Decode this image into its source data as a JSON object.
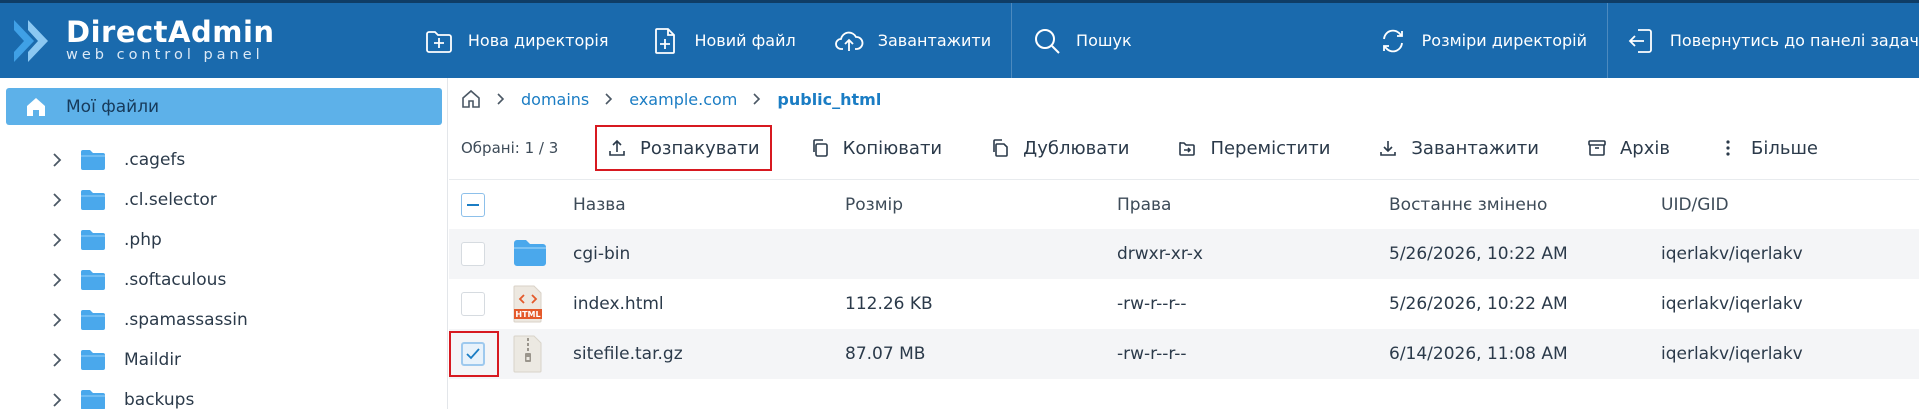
{
  "header": {
    "logo_title": "DirectAdmin",
    "logo_subtitle": "web control panel",
    "buttons": {
      "new_dir": "Нова директорія",
      "new_file": "Новий файл",
      "upload": "Завантажити",
      "search": "Пошук",
      "dir_sizes": "Розміри директорій",
      "back": "Повернутись до панелі задач"
    }
  },
  "sidebar": {
    "active_label": "Мої файли",
    "items": [
      ".cagefs",
      ".cl.selector",
      ".php",
      ".softaculous",
      ".spamassassin",
      "Maildir",
      "backups"
    ]
  },
  "breadcrumb": {
    "items": [
      "domains",
      "example.com"
    ],
    "current": "public_html"
  },
  "toolbar": {
    "selected": "Обрані: 1 / 3",
    "extract": "Розпакувати",
    "copy": "Копіювати",
    "duplicate": "Дублювати",
    "move": "Перемістити",
    "download": "Завантажити",
    "archive": "Архів",
    "more": "Більше"
  },
  "table": {
    "headers": {
      "name": "Назва",
      "size": "Розмір",
      "perms": "Права",
      "modified": "Востаннє змінено",
      "owner": "UID/GID"
    },
    "rows": [
      {
        "name": "cgi-bin",
        "size": "",
        "perms": "drwxr-xr-x",
        "modified": "5/26/2026, 10:22 AM",
        "owner": "iqerlakv/iqerlakv",
        "icon": "folder-icon",
        "checked": false
      },
      {
        "name": "index.html",
        "size": "112.26 KB",
        "perms": "-rw-r--r--",
        "modified": "5/26/2026, 10:22 AM",
        "owner": "iqerlakv/iqerlakv",
        "icon": "html-file-icon",
        "icon_label": "HTML",
        "checked": false
      },
      {
        "name": "sitefile.tar.gz",
        "size": "87.07 MB",
        "perms": "-rw-r--r--",
        "modified": "6/14/2026, 11:08 AM",
        "owner": "iqerlakv/iqerlakv",
        "icon": "archive-file-icon",
        "checked": true
      }
    ]
  },
  "colors": {
    "header_bg": "#1a6aad",
    "accent": "#1b7dc4",
    "sidebar_active": "#5db1e9",
    "highlight_border": "#d71920",
    "folder": "#4aa8ec"
  }
}
